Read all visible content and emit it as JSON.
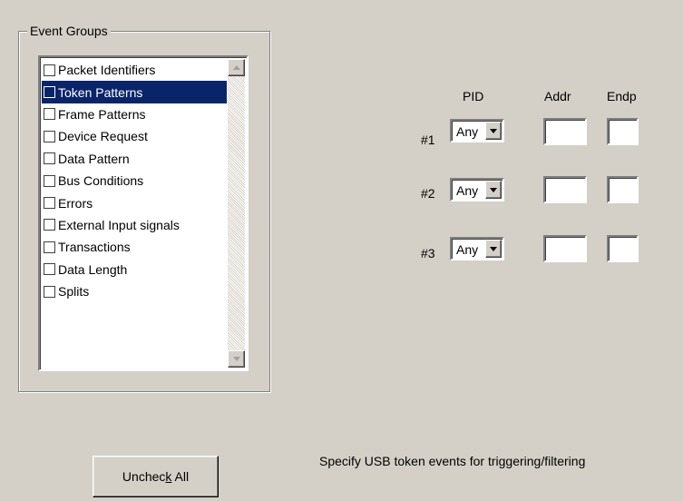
{
  "event_groups": {
    "title": "Event Groups",
    "items": [
      {
        "label": "Packet Identifiers",
        "checked": false,
        "selected": false
      },
      {
        "label": "Token Patterns",
        "checked": false,
        "selected": true
      },
      {
        "label": "Frame Patterns",
        "checked": false,
        "selected": false
      },
      {
        "label": "Device Request",
        "checked": false,
        "selected": false
      },
      {
        "label": "Data Pattern",
        "checked": false,
        "selected": false
      },
      {
        "label": "Bus Conditions",
        "checked": false,
        "selected": false
      },
      {
        "label": "Errors",
        "checked": false,
        "selected": false
      },
      {
        "label": "External Input signals",
        "checked": false,
        "selected": false
      },
      {
        "label": "Transactions",
        "checked": false,
        "selected": false
      },
      {
        "label": "Data Length",
        "checked": false,
        "selected": false
      },
      {
        "label": "Splits",
        "checked": false,
        "selected": false
      }
    ]
  },
  "token_table": {
    "headers": {
      "pid": "PID",
      "addr": "Addr",
      "endp": "Endp"
    },
    "rows": [
      {
        "label": "#1",
        "pid": "Any",
        "addr": "",
        "endp": ""
      },
      {
        "label": "#2",
        "pid": "Any",
        "addr": "",
        "endp": ""
      },
      {
        "label": "#3",
        "pid": "Any",
        "addr": "",
        "endp": ""
      }
    ]
  },
  "buttons": {
    "uncheck_all_pre": "Unchec",
    "uncheck_all_key": "k",
    "uncheck_all_post": " All"
  },
  "status": {
    "hint": "Specify USB token events for triggering/filtering"
  },
  "colors": {
    "face": "#d4d0c8",
    "selection": "#0a246a"
  },
  "icons": {
    "scroll_up": "scroll-up-arrow-icon",
    "scroll_down": "scroll-down-arrow-icon",
    "dropdown": "dropdown-arrow-icon"
  }
}
